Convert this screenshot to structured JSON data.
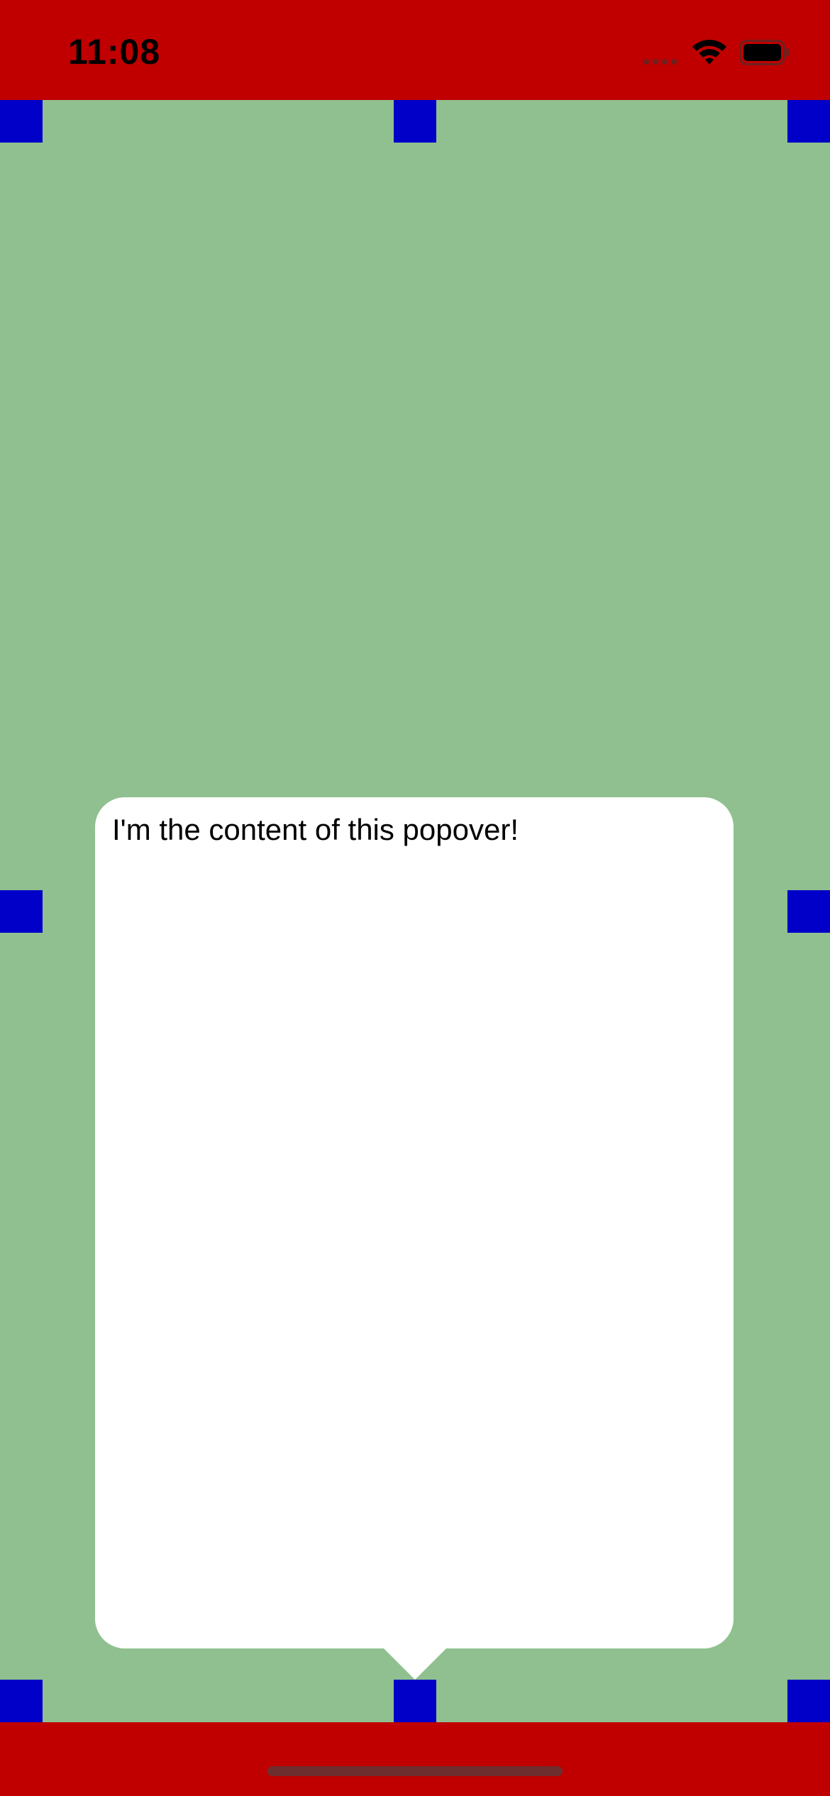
{
  "status_bar": {
    "time": "11:08",
    "icons": [
      "cellular-signal-icon",
      "wifi-icon",
      "battery-icon"
    ]
  },
  "popover": {
    "content_text": "I'm the content of this popover!"
  },
  "colors": {
    "status_bar_background": "#c00000",
    "page_background": "#90c090",
    "anchor_marker": "#0000c8",
    "popover_background": "#ffffff",
    "home_indicator": "#6e2e2e"
  }
}
